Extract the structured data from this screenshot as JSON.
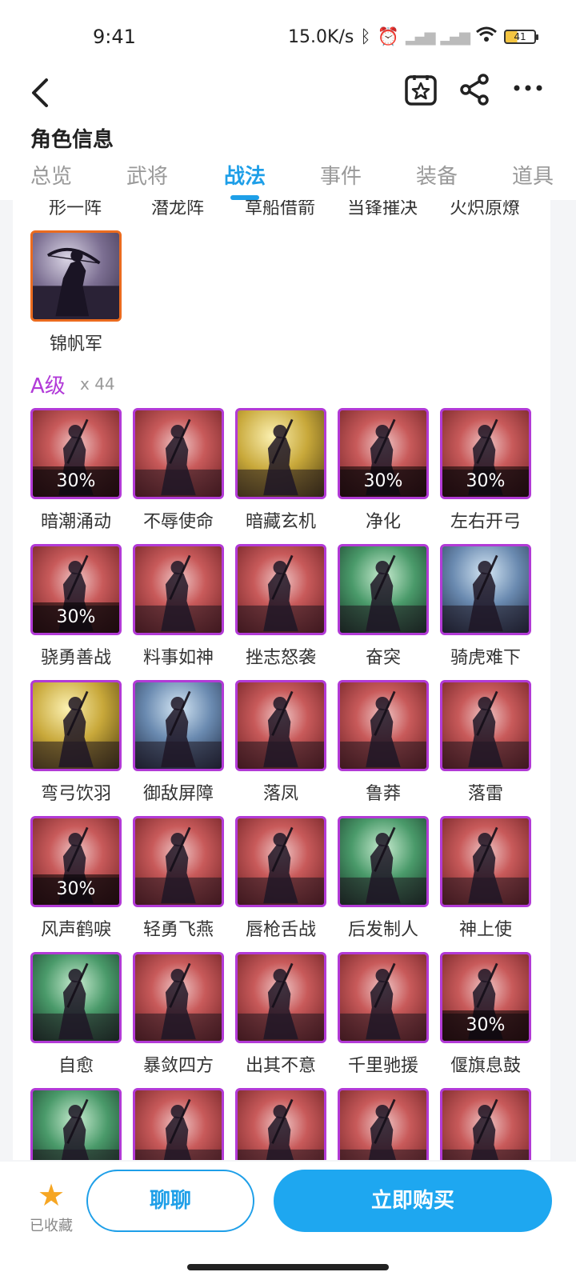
{
  "status": {
    "time": "9:41",
    "net_speed": "15.0K/s",
    "battery": "41"
  },
  "header": {
    "title": "角色信息"
  },
  "tabs": [
    {
      "label": "总览"
    },
    {
      "label": "武将"
    },
    {
      "label": "战法"
    },
    {
      "label": "事件"
    },
    {
      "label": "装备"
    },
    {
      "label": "道具"
    }
  ],
  "cut_row": [
    "形一阵",
    "潜龙阵",
    "草船借箭",
    "当锋摧决",
    "火炽原燎"
  ],
  "s_grade_last": {
    "name": "锦帆军"
  },
  "a_grade": {
    "title": "A级",
    "count": "x 44",
    "skills": [
      {
        "name": "暗潮涌动",
        "badge": "30%",
        "theme": "red"
      },
      {
        "name": "不辱使命",
        "badge": "",
        "theme": "red"
      },
      {
        "name": "暗藏玄机",
        "badge": "",
        "theme": "gold"
      },
      {
        "name": "净化",
        "badge": "30%",
        "theme": "red"
      },
      {
        "name": "左右开弓",
        "badge": "30%",
        "theme": "red"
      },
      {
        "name": "骁勇善战",
        "badge": "30%",
        "theme": "red"
      },
      {
        "name": "料事如神",
        "badge": "",
        "theme": "red"
      },
      {
        "name": "挫志怒袭",
        "badge": "",
        "theme": "red"
      },
      {
        "name": "奋突",
        "badge": "",
        "theme": "green"
      },
      {
        "name": "骑虎难下",
        "badge": "",
        "theme": "blue"
      },
      {
        "name": "弯弓饮羽",
        "badge": "",
        "theme": "gold"
      },
      {
        "name": "御敌屏障",
        "badge": "",
        "theme": "blue"
      },
      {
        "name": "落凤",
        "badge": "",
        "theme": "red"
      },
      {
        "name": "鲁莽",
        "badge": "",
        "theme": "red"
      },
      {
        "name": "落雷",
        "badge": "",
        "theme": "red"
      },
      {
        "name": "风声鹤唳",
        "badge": "30%",
        "theme": "red"
      },
      {
        "name": "轻勇飞燕",
        "badge": "",
        "theme": "red"
      },
      {
        "name": "唇枪舌战",
        "badge": "",
        "theme": "red"
      },
      {
        "name": "后发制人",
        "badge": "",
        "theme": "green"
      },
      {
        "name": "神上使",
        "badge": "",
        "theme": "red"
      },
      {
        "name": "自愈",
        "badge": "",
        "theme": "green"
      },
      {
        "name": "暴敛四方",
        "badge": "",
        "theme": "red"
      },
      {
        "name": "出其不意",
        "badge": "",
        "theme": "red"
      },
      {
        "name": "千里驰援",
        "badge": "",
        "theme": "red"
      },
      {
        "name": "偃旗息鼓",
        "badge": "30%",
        "theme": "red"
      },
      {
        "name": "",
        "badge": "",
        "theme": "green"
      },
      {
        "name": "",
        "badge": "",
        "theme": "red"
      },
      {
        "name": "",
        "badge": "",
        "theme": "red"
      },
      {
        "name": "",
        "badge": "",
        "theme": "red"
      },
      {
        "name": "",
        "badge": "",
        "theme": "red"
      }
    ]
  },
  "bottom": {
    "fav_label": "已收藏",
    "chat_label": "聊聊",
    "buy_label": "立即购买"
  },
  "colors": {
    "accent": "#1e9fe8",
    "a_grade": "#b13ad8",
    "s_grade": "#ea6b1f",
    "star": "#f6a623"
  }
}
